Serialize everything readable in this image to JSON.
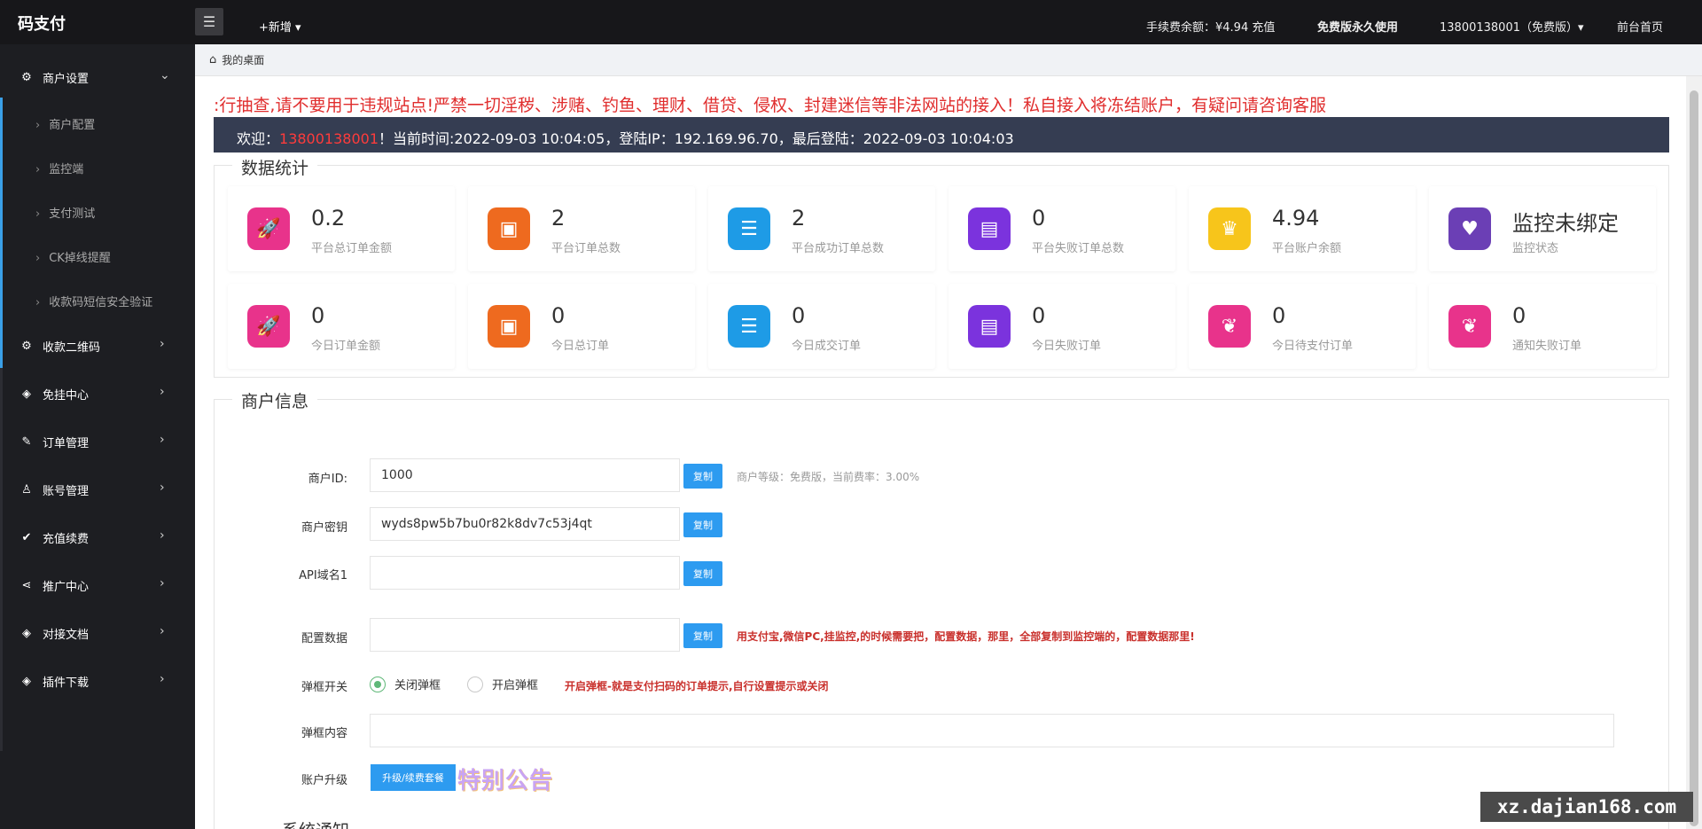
{
  "app": {
    "logo": "码支付",
    "add_label": "+新增 ▾"
  },
  "topbar": {
    "fee_balance": "手续费余额：¥4.94 充值",
    "plan": "免费版永久使用",
    "user": "13800138001（免费版）▾",
    "frontpage": "前台首页"
  },
  "sidebar": {
    "merchant_settings": "商户设置",
    "sub_items": [
      "商户配置",
      "监控端",
      "支付测试",
      "CK掉线提醒",
      "收款码短信安全验证"
    ],
    "items": [
      "收款二维码",
      "免挂中心",
      "订单管理",
      "账号管理",
      "充值续费",
      "推广中心",
      "对接文档",
      "插件下载"
    ]
  },
  "breadcrumb": {
    "tab": "我的桌面"
  },
  "notice": ":行抽查,请不要用于违规站点!严禁一切淫秽、涉赌、钓鱼、理财、借贷、侵权、封建迷信等非法网站的接入！私自接入将冻结账户，有疑问请咨询客服",
  "welcome": {
    "prefix": "欢迎：",
    "account": "13800138001",
    "suffix": "！当前时间:2022-09-03 10:04:05，登陆IP：192.169.96.70，最后登陆：2022-09-03 10:04:03"
  },
  "stats": {
    "legend": "数据统计",
    "row1": [
      {
        "value": "0.2",
        "label": "平台总订单金额",
        "icon": "rocket-icon",
        "color": "#e8338b"
      },
      {
        "value": "2",
        "label": "平台订单总数",
        "icon": "ticket-icon",
        "color": "#ee6a1f"
      },
      {
        "value": "2",
        "label": "平台成功订单总数",
        "icon": "wallet-icon",
        "color": "#1e9be6"
      },
      {
        "value": "0",
        "label": "平台失败订单总数",
        "icon": "jar-icon",
        "color": "#7b33dd"
      },
      {
        "value": "4.94",
        "label": "平台账户余额",
        "icon": "crown-icon",
        "color": "#f7c51b"
      },
      {
        "value": "监控未绑定",
        "label": "监控状态",
        "icon": "heart-icon",
        "color": "#6b3fb5"
      }
    ],
    "row2": [
      {
        "value": "0",
        "label": "今日订单金额",
        "icon": "rocket-icon",
        "color": "#e8338b"
      },
      {
        "value": "0",
        "label": "今日总订单",
        "icon": "ticket-icon",
        "color": "#ee6a1f"
      },
      {
        "value": "0",
        "label": "今日成交订单",
        "icon": "wallet-icon",
        "color": "#1e9be6"
      },
      {
        "value": "0",
        "label": "今日失败订单",
        "icon": "jar-icon",
        "color": "#7b33dd"
      },
      {
        "value": "0",
        "label": "今日待支付订单",
        "icon": "flame-icon",
        "color": "#e8338b"
      },
      {
        "value": "0",
        "label": "通知失败订单",
        "icon": "flame-icon",
        "color": "#e8338b"
      }
    ]
  },
  "merchant": {
    "legend": "商户信息",
    "id_label": "商户ID:",
    "id_value": "1000",
    "level_tip": "商户等级：免费版，当前费率：3.00%",
    "key_label": "商户密钥",
    "key_value": "wyds8pw5b7bu0r82k8dv7c53j4qt",
    "api_label": "API域名1",
    "config_label": "配置数据",
    "config_tip": "用支付宝,微信PC,挂监控,的时候需要把，配置数据，那里，全部复制到监控端的，配置数据那里!",
    "popup_label": "弹框开关",
    "popup_off": "关闭弹框",
    "popup_on": "开启弹框",
    "popup_tip": "开启弹框-就是支付扫码的订单提示,自行设置提示或关闭",
    "popup_content_label": "弹框内容",
    "upgrade_label": "账户升级",
    "upgrade_button": "升级/续费套餐",
    "special_notice": "特别公告",
    "copy": "复制"
  },
  "system_notice": "系统通知",
  "watermark": "xz.dajian168.com"
}
